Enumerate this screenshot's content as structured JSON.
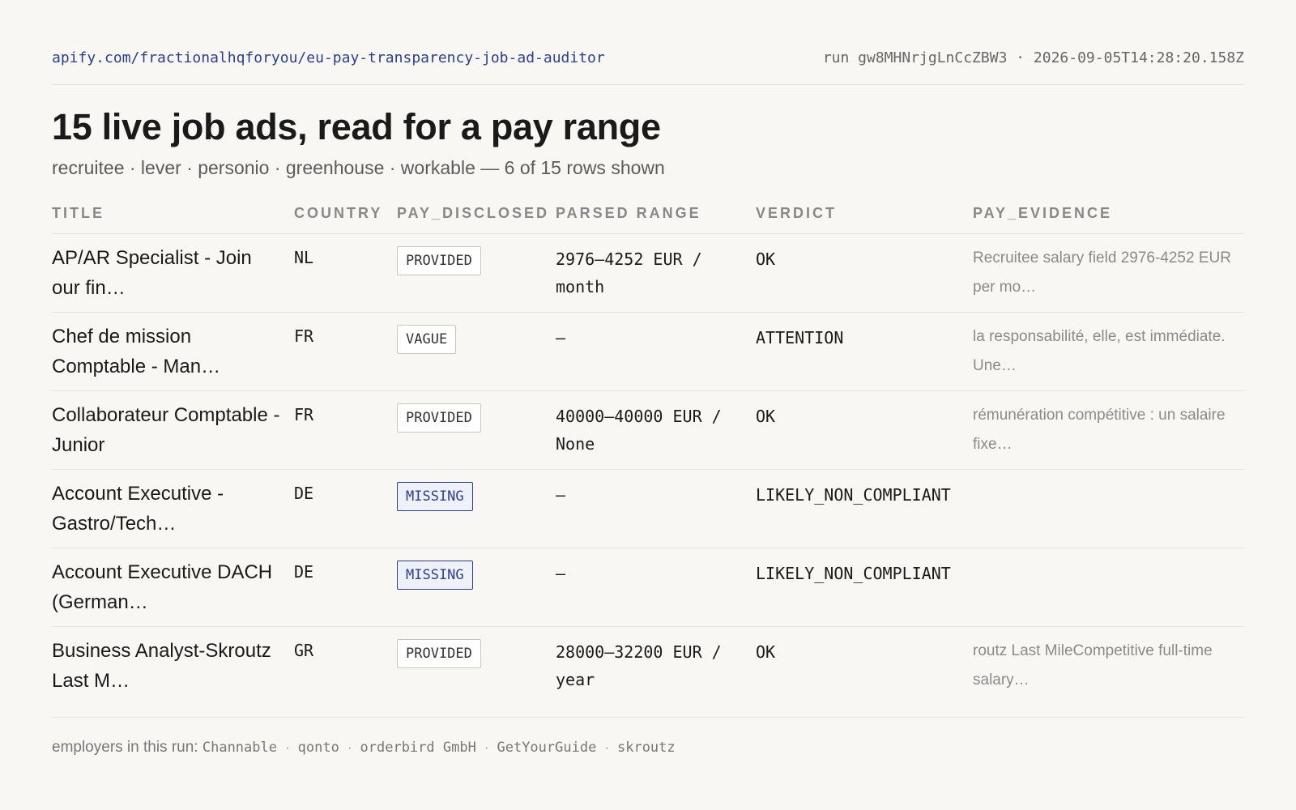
{
  "header": {
    "url": "apify.com/fractionalhqforyou/eu-pay-transparency-job-ad-auditor",
    "run_info": "run gw8MHNrjgLnCcZBW3 · 2026-09-05T14:28:20.158Z"
  },
  "title": "15 live job ads, read for a pay range",
  "subtitle": "recruitee · lever · personio · greenhouse · workable — 6 of 15 rows shown",
  "table": {
    "columns": [
      "TITLE",
      "COUNTRY",
      "PAY_DISCLOSED",
      "PARSED RANGE",
      "VERDICT",
      "PAY_EVIDENCE"
    ],
    "rows": [
      {
        "title": "AP/AR Specialist - Join our fin…",
        "country": "NL",
        "pay_disclosed": "PROVIDED",
        "range": "2976–4252 EUR / month",
        "verdict": "OK",
        "evidence": "Recruitee salary field 2976-4252 EUR per mo…"
      },
      {
        "title": "Chef de mission Comptable - Man…",
        "country": "FR",
        "pay_disclosed": "VAGUE",
        "range": "—",
        "verdict": "ATTENTION",
        "evidence": "la responsabilité, elle, est immédiate. Une…"
      },
      {
        "title": "Collaborateur Comptable - Junior",
        "country": "FR",
        "pay_disclosed": "PROVIDED",
        "range": "40000–40000 EUR / None",
        "verdict": "OK",
        "evidence": "rémunération compétitive : un salaire fixe…"
      },
      {
        "title": "Account Executive - Gastro/Tech…",
        "country": "DE",
        "pay_disclosed": "MISSING",
        "range": "—",
        "verdict": "LIKELY_NON_COMPLIANT",
        "evidence": ""
      },
      {
        "title": "Account Executive DACH (German…",
        "country": "DE",
        "pay_disclosed": "MISSING",
        "range": "—",
        "verdict": "LIKELY_NON_COMPLIANT",
        "evidence": ""
      },
      {
        "title": "Business Analyst-Skroutz Last M…",
        "country": "GR",
        "pay_disclosed": "PROVIDED",
        "range": "28000–32200 EUR / year",
        "verdict": "OK",
        "evidence": "routz Last MileCompetitive full-time salary…"
      }
    ]
  },
  "footer": {
    "label": "employers in this run:",
    "employers": [
      "Channable",
      "qonto",
      "orderbird GmbH",
      "GetYourGuide",
      "skroutz"
    ]
  },
  "colors": {
    "accent": "#2a3f8f",
    "background": "#f8f7f4"
  }
}
